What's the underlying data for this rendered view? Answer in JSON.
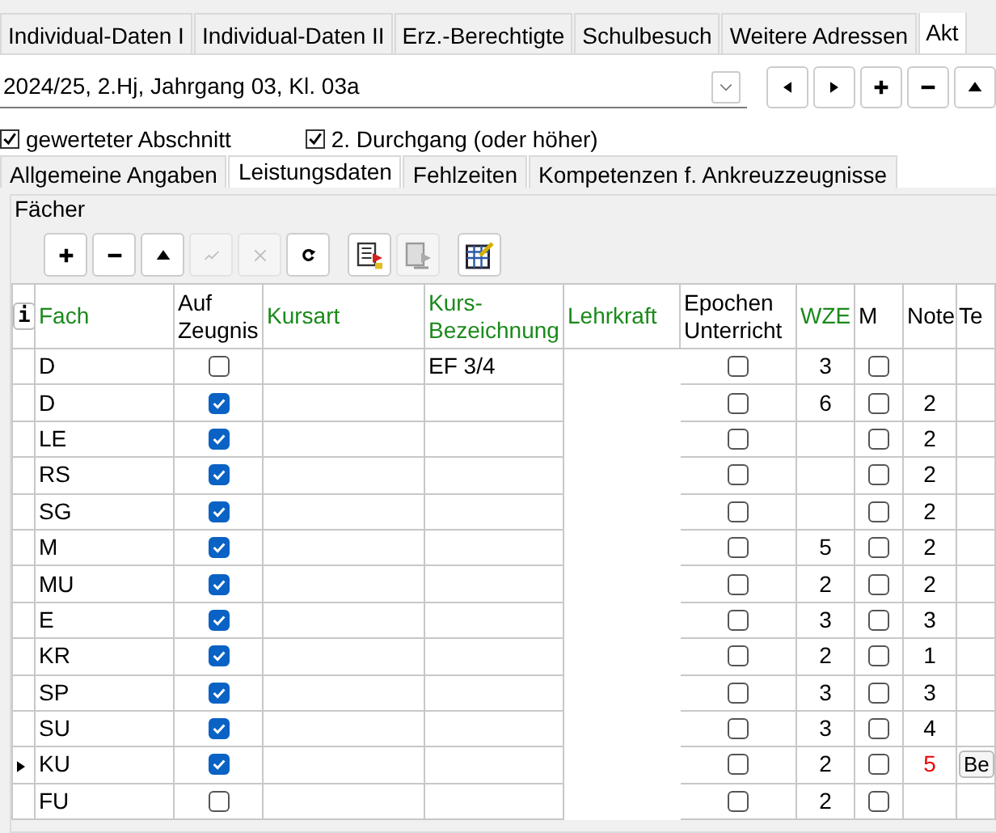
{
  "top_tabs": [
    {
      "label": "Individual-Daten I",
      "selected": false
    },
    {
      "label": "Individual-Daten II",
      "selected": false
    },
    {
      "label": "Erz.-Berechtigte",
      "selected": false
    },
    {
      "label": "Schulbesuch",
      "selected": false
    },
    {
      "label": "Weitere Adressen",
      "selected": false
    },
    {
      "label": "Akt",
      "selected": true
    }
  ],
  "section_select": {
    "value": "2024/25, 2.Hj, Jahrgang 03, Kl. 03a"
  },
  "nav_buttons": [
    {
      "kind": "prev"
    },
    {
      "kind": "next"
    },
    {
      "kind": "add"
    },
    {
      "kind": "remove"
    },
    {
      "kind": "up"
    }
  ],
  "options": [
    {
      "label": "gewerteter Abschnitt",
      "checked": true
    },
    {
      "label": "2. Durchgang (oder höher)",
      "checked": true
    }
  ],
  "sub_tabs": [
    {
      "label": "Allgemeine Angaben",
      "selected": false
    },
    {
      "label": "Leistungsdaten",
      "selected": true
    },
    {
      "label": "Fehlzeiten",
      "selected": false
    },
    {
      "label": "Kompetenzen f. Ankreuzzeugnisse",
      "selected": false
    }
  ],
  "group": {
    "title": "Fächer"
  },
  "toolbar": [
    {
      "kind": "add",
      "disabled": false
    },
    {
      "kind": "remove",
      "disabled": false
    },
    {
      "kind": "up",
      "disabled": false
    },
    {
      "kind": "confirm",
      "disabled": true
    },
    {
      "kind": "cancel",
      "disabled": true
    },
    {
      "kind": "refresh",
      "disabled": false
    },
    {
      "kind": "doc-red",
      "disabled": false
    },
    {
      "kind": "doc-grey",
      "disabled": true
    },
    {
      "kind": "table-edit",
      "disabled": false
    }
  ],
  "table": {
    "info_button": "i",
    "columns": [
      {
        "label": "Fach",
        "key_field": true
      },
      {
        "label": "Auf Zeugnis",
        "key_field": false
      },
      {
        "label": "Kursart",
        "key_field": true
      },
      {
        "label": "Kurs-Bezeichnung",
        "key_field": true
      },
      {
        "label": "Lehrkraft",
        "key_field": true
      },
      {
        "label": "Epochen Unterricht",
        "key_field": false
      },
      {
        "label": "WZE",
        "key_field": true
      },
      {
        "label": "M",
        "key_field": false
      },
      {
        "label": "Note",
        "key_field": false
      },
      {
        "label": "Te",
        "key_field": false
      }
    ],
    "rows": [
      {
        "fach": "D",
        "auf_zeugnis": false,
        "kurs_bezeichnung": "EF 3/4",
        "epochen": false,
        "wze": "3",
        "m": false,
        "note": "",
        "selected": false
      },
      {
        "fach": "D",
        "auf_zeugnis": true,
        "kurs_bezeichnung": "",
        "epochen": false,
        "wze": "6",
        "m": false,
        "note": "2",
        "note_warning": false,
        "selected": false
      },
      {
        "fach": "LE",
        "auf_zeugnis": true,
        "kurs_bezeichnung": "",
        "epochen": false,
        "wze": "",
        "m": false,
        "note": "2",
        "note_warning": false,
        "selected": false
      },
      {
        "fach": "RS",
        "auf_zeugnis": true,
        "kurs_bezeichnung": "",
        "epochen": false,
        "wze": "",
        "m": false,
        "note": "2",
        "note_warning": false,
        "selected": false
      },
      {
        "fach": "SG",
        "auf_zeugnis": true,
        "kurs_bezeichnung": "",
        "epochen": false,
        "wze": "",
        "m": false,
        "note": "2",
        "note_warning": false,
        "selected": false
      },
      {
        "fach": "M",
        "auf_zeugnis": true,
        "kurs_bezeichnung": "",
        "epochen": false,
        "wze": "5",
        "m": false,
        "note": "2",
        "note_warning": false,
        "selected": false
      },
      {
        "fach": "MU",
        "auf_zeugnis": true,
        "kurs_bezeichnung": "",
        "epochen": false,
        "wze": "2",
        "m": false,
        "note": "2",
        "note_warning": false,
        "selected": false
      },
      {
        "fach": "E",
        "auf_zeugnis": true,
        "kurs_bezeichnung": "",
        "epochen": false,
        "wze": "3",
        "m": false,
        "note": "3",
        "note_warning": false,
        "selected": false
      },
      {
        "fach": "KR",
        "auf_zeugnis": true,
        "kurs_bezeichnung": "",
        "epochen": false,
        "wze": "2",
        "m": false,
        "note": "1",
        "note_warning": false,
        "selected": false
      },
      {
        "fach": "SP",
        "auf_zeugnis": true,
        "kurs_bezeichnung": "",
        "epochen": false,
        "wze": "3",
        "m": false,
        "note": "3",
        "note_warning": false,
        "selected": false
      },
      {
        "fach": "SU",
        "auf_zeugnis": true,
        "kurs_bezeichnung": "",
        "epochen": false,
        "wze": "3",
        "m": false,
        "note": "4",
        "note_warning": false,
        "selected": false
      },
      {
        "fach": "KU",
        "auf_zeugnis": true,
        "kurs_bezeichnung": "",
        "epochen": false,
        "wze": "2",
        "m": false,
        "note": "5",
        "note_warning": true,
        "selected": true,
        "te_button": "Be"
      },
      {
        "fach": "FU",
        "auf_zeugnis": false,
        "kurs_bezeichnung": "",
        "epochen": false,
        "wze": "2",
        "m": false,
        "note": "",
        "selected": false
      }
    ]
  }
}
